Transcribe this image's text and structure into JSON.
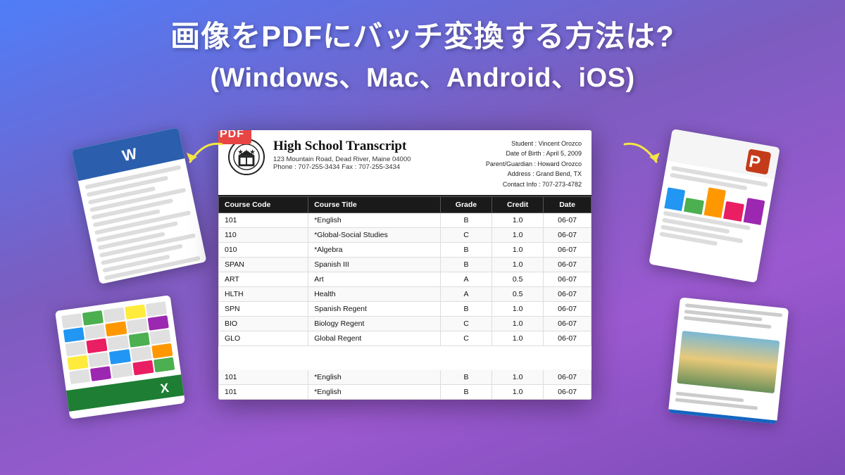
{
  "page": {
    "title_line1": "画像をPDFにバッチ変換する方法は?",
    "title_line2": "(Windows、Mac、Android、iOS)",
    "pdf_badge": "PDF",
    "document": {
      "title": "High School Transcript",
      "address": "123 Mountain Road, Dead River, Maine 04000",
      "phone": "Phone : 707-255-3434   Fax : 707-255-3434",
      "student": {
        "name": "Student : Vincent Orozco",
        "dob": "Date of Birth : April 5,  2009",
        "parent": "Parent/Guardian : Howard Orozco",
        "address": "Address : Grand Bend, TX",
        "contact": "Contact Info : 707-273-4782"
      },
      "table": {
        "headers": [
          "Course Code",
          "Course Title",
          "Grade",
          "Credit",
          "Date"
        ],
        "rows": [
          [
            "101",
            "*English",
            "B",
            "1.0",
            "06-07"
          ],
          [
            "110",
            "*Global-Social Studies",
            "C",
            "1.0",
            "06-07"
          ],
          [
            "010",
            "*Algebra",
            "B",
            "1.0",
            "06-07"
          ],
          [
            "SPAN",
            "Spanish III",
            "B",
            "1.0",
            "06-07"
          ],
          [
            "ART",
            "Art",
            "A",
            "0.5",
            "06-07"
          ],
          [
            "HLTH",
            "Health",
            "A",
            "0.5",
            "06-07"
          ],
          [
            "SPN",
            "Spanish Regent",
            "B",
            "1.0",
            "06-07"
          ],
          [
            "BIO",
            "Biology Regent",
            "C",
            "1.0",
            "06-07"
          ],
          [
            "GLO",
            "Global Regent",
            "C",
            "1.0",
            "06-07"
          ],
          [
            "",
            "",
            "",
            "",
            ""
          ],
          [
            "",
            "",
            "",
            "",
            ""
          ],
          [
            "101",
            "*English",
            "B",
            "1.0",
            "06-07"
          ],
          [
            "101",
            "*English",
            "B",
            "1.0",
            "06-07"
          ]
        ]
      }
    }
  }
}
